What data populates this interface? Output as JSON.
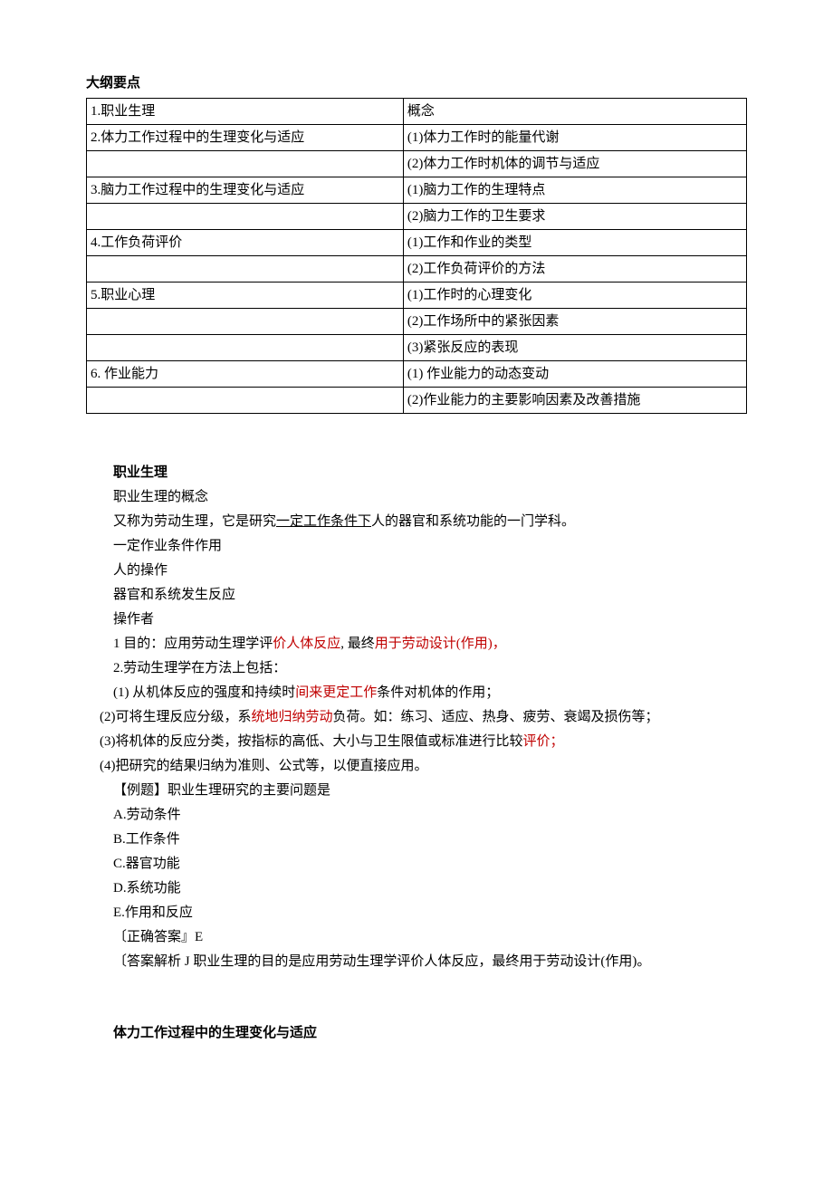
{
  "headings": {
    "outline": "大纲要点",
    "section1": "职业生理",
    "section2": "体力工作过程中的生理变化与适应"
  },
  "table": {
    "rows": [
      {
        "c0": "1.职业生理",
        "c1": "概念"
      },
      {
        "c0": "2.体力工作过程中的生理变化与适应",
        "c1": "(1)体力工作时的能量代谢"
      },
      {
        "c0": "",
        "c1": "(2)体力工作时机体的调节与适应"
      },
      {
        "c0": "3.脑力工作过程中的生理变化与适应",
        "c1": "(1)脑力工作的生理特点"
      },
      {
        "c0": "",
        "c1": "(2)脑力工作的卫生要求"
      },
      {
        "c0": "4.工作负荷评价",
        "c1": "(1)工作和作业的类型"
      },
      {
        "c0": "",
        "c1": "(2)工作负荷评价的方法"
      },
      {
        "c0": "5.职业心理",
        "c1": "(1)工作时的心理变化"
      },
      {
        "c0": "",
        "c1": "(2)工作场所中的紧张因素"
      },
      {
        "c0": "",
        "c1": "(3)紧张反应的表现"
      },
      {
        "c0": "6. 作业能力",
        "c1": "(1) 作业能力的动态变动"
      },
      {
        "c0": "",
        "c1": "(2)作业能力的主要影响因素及改善措施"
      }
    ]
  },
  "body": {
    "p1": "职业生理的概念",
    "p2a": "又称为劳动生理，它是研究",
    "p2b": "一定工作条件下",
    "p2c": "人的器官和系统功能的一门学科。",
    "p3": "一定作业条件作用",
    "p4": "人的操作",
    "p5": "器官和系统发生反应",
    "p6": "操作者",
    "p7a": "1 目的：应用劳动生理学评",
    "p7b": "价人体反应",
    "p7c": ", 最终",
    "p7d": "用于劳动设计(作用)，",
    "p8": "2.劳动生理学在方法上包括：",
    "p9a": "(1) 从机体反应的强度和持续时",
    "p9b": "间来更定工作",
    "p9c": "条件对机体的作用；",
    "p10a": "(2)可将生理反应分级，系",
    "p10b": "统地归纳劳动",
    "p10c": "负荷。如：练习、适应、热身、疲劳、衰竭及损伤等；",
    "p11a": "(3)将机体的反应分类，按指标的高低、大小与卫生限值或标准进行比较",
    "p11b": "评价；",
    "p12": "(4)把研究的结果归纳为准则、公式等，以便直接应用。",
    "p13": "【例题】职业生理研究的主要问题是",
    "optA": "A.劳动条件",
    "optB": "B.工作条件",
    "optC": "C.器官功能",
    "optD": "D.系统功能",
    "optE": "E.作用和反应",
    "ans": "〔正确答案』E",
    "exp": "〔答案解析 J 职业生理的目的是应用劳动生理学评价人体反应，最终用于劳动设计(作用)。"
  }
}
